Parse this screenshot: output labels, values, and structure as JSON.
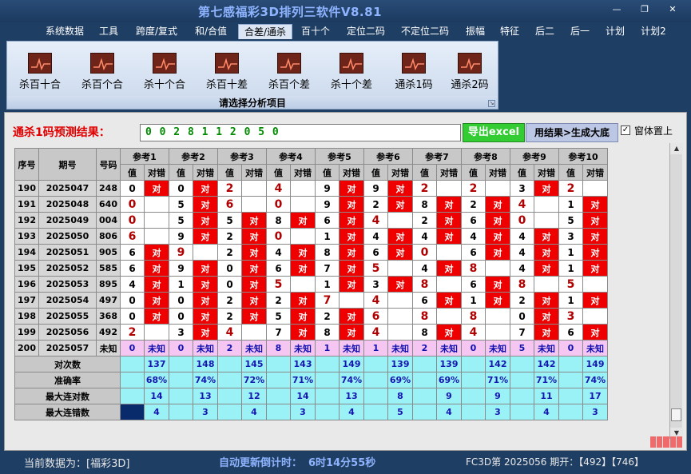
{
  "app": {
    "title": "第七感福彩3D排列三软件V8.81",
    "window_controls": [
      "minimize-icon",
      "restore-icon",
      "close-icon"
    ]
  },
  "menu": [
    "系统数据",
    "工具",
    "跨度/复式",
    "和/合值",
    "合差/通杀",
    "百十个",
    "定位二码",
    "不定位二码",
    "振幅",
    "特征",
    "后二",
    "后一",
    "计划",
    "计划2"
  ],
  "active_menu": "合差/通杀",
  "ribbon": {
    "buttons": [
      "杀百十合",
      "杀百个合",
      "杀十个合",
      "杀百十差",
      "杀百个差",
      "杀十个差",
      "通杀1码",
      "通杀2码"
    ],
    "caption": "请选择分析项目"
  },
  "prediction": {
    "label": "通杀1码预测结果：",
    "value": "0 0 2 8 1 1 2 0 5 0",
    "export_label": "导出excel",
    "generate_label": "用结果>生成大底",
    "topmost_label": "窗体置上",
    "topmost_checked": true
  },
  "table": {
    "headers": {
      "seq": "序号",
      "period": "期号",
      "number": "号码",
      "ref_prefix": "参考",
      "sub_value": "值",
      "sub_check": "对错"
    },
    "refs": [
      "参考1",
      "参考2",
      "参考3",
      "参考4",
      "参考5",
      "参考6",
      "参考7",
      "参考8",
      "参考9",
      "参考10"
    ],
    "rows": [
      {
        "seq": "190",
        "period": "2025047",
        "number": "248",
        "cells": [
          [
            "0",
            "对"
          ],
          [
            "0",
            "对"
          ],
          [
            "2",
            ""
          ],
          [
            "4",
            ""
          ],
          [
            "9",
            "对"
          ],
          [
            "9",
            "对"
          ],
          [
            "2",
            ""
          ],
          [
            "2",
            ""
          ],
          [
            "3",
            "对"
          ],
          [
            "2",
            ""
          ]
        ]
      },
      {
        "seq": "191",
        "period": "2025048",
        "number": "640",
        "cells": [
          [
            "0",
            ""
          ],
          [
            "5",
            "对"
          ],
          [
            "6",
            ""
          ],
          [
            "0",
            ""
          ],
          [
            "9",
            "对"
          ],
          [
            "2",
            "对"
          ],
          [
            "8",
            "对"
          ],
          [
            "2",
            "对"
          ],
          [
            "4",
            ""
          ],
          [
            "1",
            "对"
          ]
        ]
      },
      {
        "seq": "192",
        "period": "2025049",
        "number": "004",
        "cells": [
          [
            "0",
            ""
          ],
          [
            "5",
            "对"
          ],
          [
            "5",
            "对"
          ],
          [
            "8",
            "对"
          ],
          [
            "6",
            "对"
          ],
          [
            "4",
            ""
          ],
          [
            "2",
            "对"
          ],
          [
            "6",
            "对"
          ],
          [
            "0",
            ""
          ],
          [
            "5",
            "对"
          ]
        ]
      },
      {
        "seq": "193",
        "period": "2025050",
        "number": "806",
        "cells": [
          [
            "6",
            ""
          ],
          [
            "9",
            "对"
          ],
          [
            "2",
            "对"
          ],
          [
            "0",
            ""
          ],
          [
            "1",
            "对"
          ],
          [
            "4",
            "对"
          ],
          [
            "4",
            "对"
          ],
          [
            "4",
            "对"
          ],
          [
            "4",
            "对"
          ],
          [
            "3",
            "对"
          ]
        ]
      },
      {
        "seq": "194",
        "period": "2025051",
        "number": "905",
        "cells": [
          [
            "6",
            "对"
          ],
          [
            "9",
            ""
          ],
          [
            "2",
            "对"
          ],
          [
            "4",
            "对"
          ],
          [
            "8",
            "对"
          ],
          [
            "6",
            "对"
          ],
          [
            "0",
            ""
          ],
          [
            "6",
            "对"
          ],
          [
            "4",
            "对"
          ],
          [
            "1",
            "对"
          ]
        ]
      },
      {
        "seq": "195",
        "period": "2025052",
        "number": "585",
        "cells": [
          [
            "6",
            "对"
          ],
          [
            "9",
            "对"
          ],
          [
            "0",
            "对"
          ],
          [
            "6",
            "对"
          ],
          [
            "7",
            "对"
          ],
          [
            "5",
            ""
          ],
          [
            "4",
            "对"
          ],
          [
            "8",
            ""
          ],
          [
            "4",
            "对"
          ],
          [
            "1",
            "对"
          ]
        ]
      },
      {
        "seq": "196",
        "period": "2025053",
        "number": "895",
        "cells": [
          [
            "4",
            "对"
          ],
          [
            "1",
            "对"
          ],
          [
            "0",
            "对"
          ],
          [
            "5",
            ""
          ],
          [
            "1",
            "对"
          ],
          [
            "3",
            "对"
          ],
          [
            "8",
            ""
          ],
          [
            "6",
            "对"
          ],
          [
            "8",
            ""
          ],
          [
            "5",
            ""
          ]
        ]
      },
      {
        "seq": "197",
        "period": "2025054",
        "number": "497",
        "cells": [
          [
            "0",
            "对"
          ],
          [
            "0",
            "对"
          ],
          [
            "2",
            "对"
          ],
          [
            "2",
            "对"
          ],
          [
            "7",
            ""
          ],
          [
            "4",
            ""
          ],
          [
            "6",
            "对"
          ],
          [
            "1",
            "对"
          ],
          [
            "2",
            "对"
          ],
          [
            "1",
            "对"
          ]
        ]
      },
      {
        "seq": "198",
        "period": "2025055",
        "number": "368",
        "cells": [
          [
            "0",
            "对"
          ],
          [
            "0",
            "对"
          ],
          [
            "2",
            "对"
          ],
          [
            "5",
            "对"
          ],
          [
            "2",
            "对"
          ],
          [
            "6",
            ""
          ],
          [
            "8",
            ""
          ],
          [
            "8",
            ""
          ],
          [
            "0",
            "对"
          ],
          [
            "3",
            ""
          ]
        ]
      },
      {
        "seq": "199",
        "period": "2025056",
        "number": "492",
        "cells": [
          [
            "2",
            ""
          ],
          [
            "3",
            "对"
          ],
          [
            "4",
            ""
          ],
          [
            "7",
            "对"
          ],
          [
            "8",
            "对"
          ],
          [
            "4",
            ""
          ],
          [
            "8",
            "对"
          ],
          [
            "4",
            ""
          ],
          [
            "7",
            "对"
          ],
          [
            "6",
            "对"
          ]
        ]
      }
    ],
    "pending": {
      "seq": "200",
      "period": "2025057",
      "number": "未知",
      "cells": [
        [
          "0",
          "未知"
        ],
        [
          "0",
          "未知"
        ],
        [
          "2",
          "未知"
        ],
        [
          "8",
          "未知"
        ],
        [
          "1",
          "未知"
        ],
        [
          "1",
          "未知"
        ],
        [
          "2",
          "未知"
        ],
        [
          "0",
          "未知"
        ],
        [
          "5",
          "未知"
        ],
        [
          "0",
          "未知"
        ]
      ]
    },
    "stats": [
      {
        "label": "对次数",
        "values": [
          "137",
          "148",
          "145",
          "143",
          "149",
          "139",
          "139",
          "142",
          "142",
          "149"
        ]
      },
      {
        "label": "准确率",
        "values": [
          "68%",
          "74%",
          "72%",
          "71%",
          "74%",
          "69%",
          "69%",
          "71%",
          "71%",
          "74%"
        ]
      },
      {
        "label": "最大连对数",
        "values": [
          "14",
          "13",
          "12",
          "14",
          "13",
          "8",
          "9",
          "9",
          "11",
          "17"
        ]
      },
      {
        "label": "最大连错数",
        "values": [
          "4",
          "3",
          "4",
          "3",
          "4",
          "5",
          "4",
          "3",
          "4",
          "3"
        ]
      }
    ]
  },
  "status": {
    "current": "当前数据为：[福彩3D]",
    "countdown_label": "自动更新倒计时：",
    "countdown_time": "6时14分55秒",
    "issue": "FC3D第 2025056 期开：【492】【746】"
  },
  "colors": {
    "hit": "#ee0000",
    "stats_bg": "#9bf2f6",
    "pending_bg": "#f5c6f2",
    "title": "#8fb4ff"
  }
}
